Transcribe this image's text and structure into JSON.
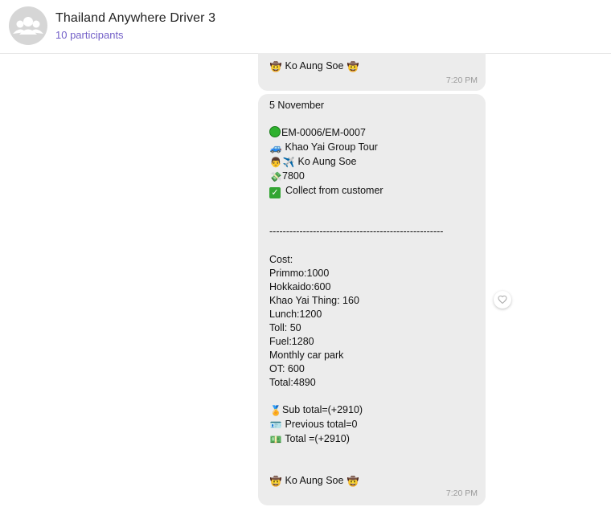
{
  "chat": {
    "title": "Thailand Anywhere Driver 3",
    "participants": "10 participants"
  },
  "messages": [
    {
      "sender_line": "Ko Aung Soe",
      "time": "7:20 PM"
    },
    {
      "date": "5 November",
      "booking": "EM-0006/EM-0007",
      "tour": "Khao Yai Group Tour",
      "driver": "Ko Aung Soe",
      "amount": "7800",
      "payment": "Collect from customer",
      "separator": "----------------------------------------------------",
      "cost_title": "Cost:",
      "costs": [
        "Primmo:1000",
        "Hokkaido:600",
        "Khao Yai Thing: 160",
        "Lunch:1200",
        "Toll: 50",
        "Fuel:1280",
        "Monthly car park",
        "OT: 600",
        "Total:4890"
      ],
      "sub_total": "Sub total=(+2910)",
      "previous_total": "Previous total=0",
      "total": "Total =(+2910)",
      "sender_line": "Ko Aung Soe",
      "time": "7:20 PM"
    }
  ],
  "icons": {
    "group_avatar": "group-avatar-icon",
    "cowboy": "cowboy-face-icon",
    "car": "car-icon",
    "person": "person-icon",
    "airplane": "airplane-icon",
    "money": "money-icon",
    "check": "check-mark-icon",
    "medal": "medal-icon",
    "id_card": "id-card-icon",
    "bill": "bill-icon",
    "heart": "heart-icon"
  },
  "colors": {
    "accent": "#7360c8",
    "bubble": "#ececec"
  }
}
